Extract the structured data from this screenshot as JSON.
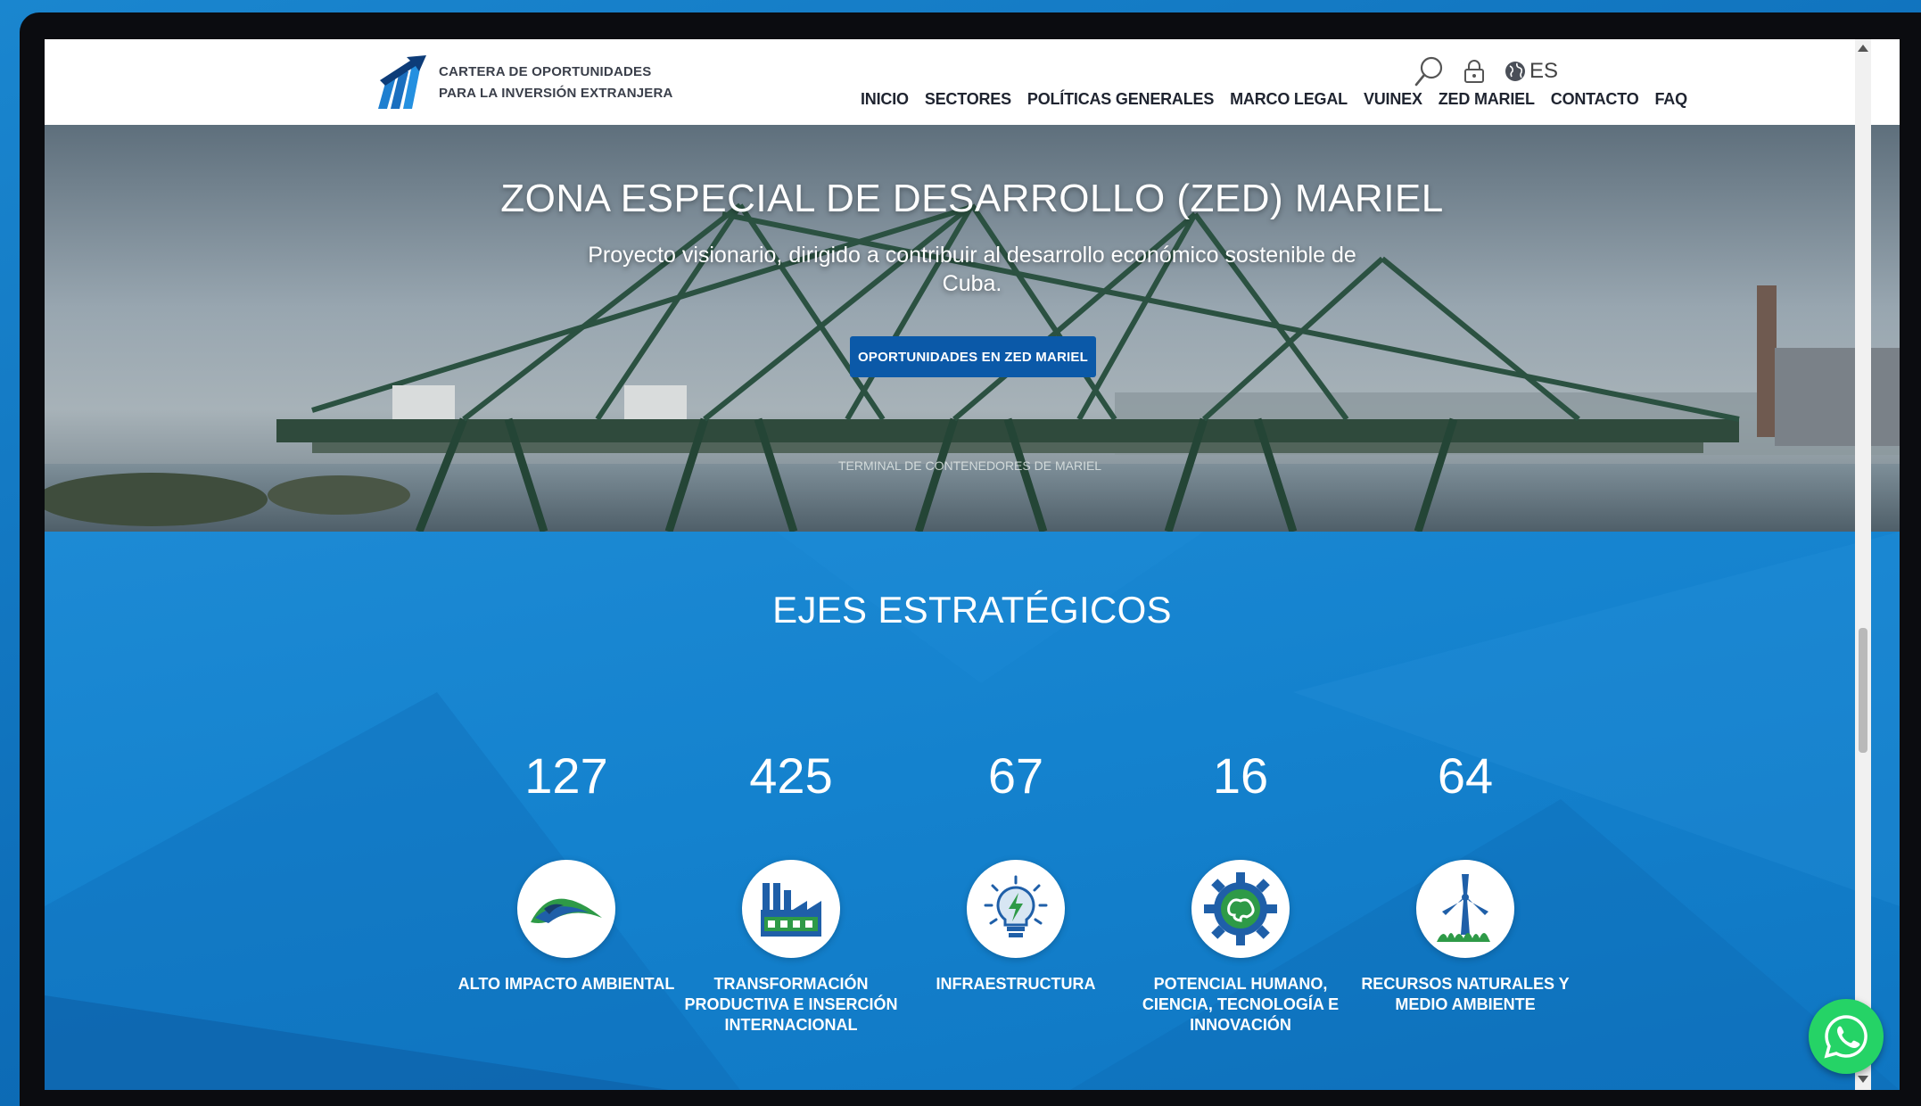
{
  "header": {
    "logo_line1": "CARTERA DE OPORTUNIDADES",
    "logo_line2": "PARA LA INVERSIÓN EXTRANJERA",
    "language": "ES",
    "nav": [
      "INICIO",
      "SECTORES",
      "POLÍTICAS GENERALES",
      "MARCO LEGAL",
      "VUINEX",
      "ZED MARIEL",
      "CONTACTO",
      "FAQ"
    ]
  },
  "hero": {
    "title": "ZONA ESPECIAL DE DESARROLLO (ZED) MARIEL",
    "subtitle": "Proyecto visionario, dirigido a contribuir al desarrollo económico sostenible de Cuba.",
    "button": "OPORTUNIDADES EN ZED MARIEL"
  },
  "axes": {
    "title": "EJES ESTRATÉGICOS",
    "items": [
      {
        "count": "127",
        "label": "ALTO IMPACTO AMBIENTAL",
        "icon": "wave-leaf-icon"
      },
      {
        "count": "425",
        "label": "TRANSFORMACIÓN PRODUCTIVA E INSERCIÓN INTERNACIONAL",
        "icon": "factory-icon"
      },
      {
        "count": "67",
        "label": "INFRAESTRUCTURA",
        "icon": "lightbulb-icon"
      },
      {
        "count": "16",
        "label": "POTENCIAL HUMANO, CIENCIA, TECNOLOGÍA E INNOVACIÓN",
        "icon": "gear-brain-icon"
      },
      {
        "count": "64",
        "label": "RECURSOS NATURALES Y MEDIO AMBIENTE",
        "icon": "wind-turbine-icon"
      }
    ]
  },
  "colors": {
    "brand_blue": "#0b59a8",
    "section_blue": "#1482ce",
    "icon_green": "#2e9a47",
    "whatsapp_green": "#25d366"
  }
}
